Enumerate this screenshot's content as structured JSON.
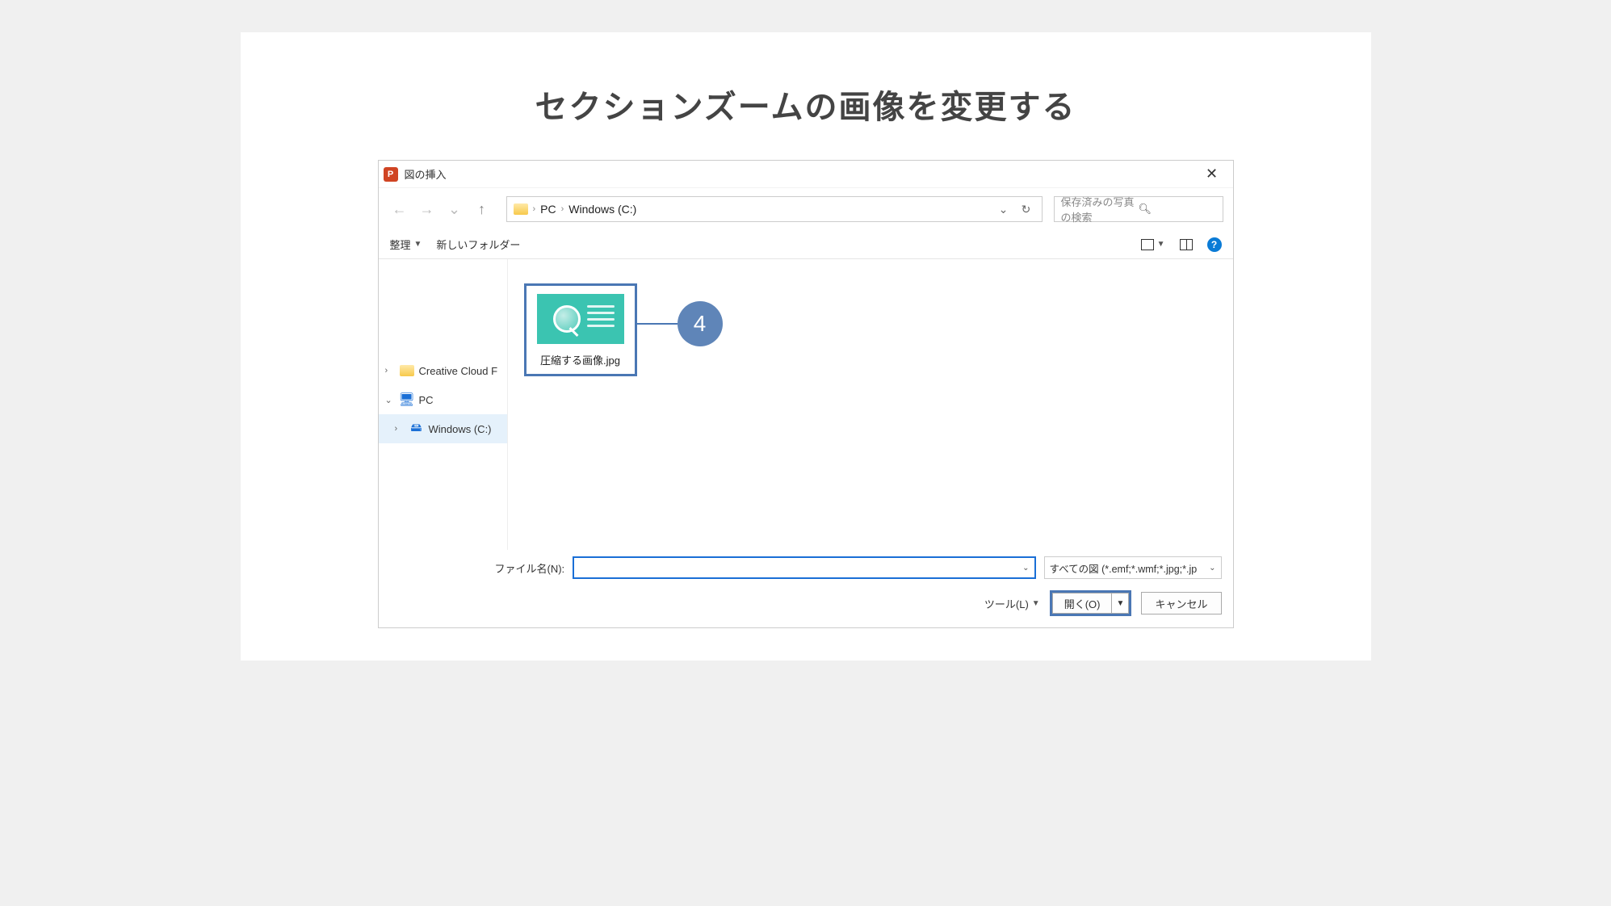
{
  "slide": {
    "title": "セクションズームの画像を変更する"
  },
  "dialog": {
    "title": "図の挿入",
    "app_icon_letter": "P"
  },
  "nav": {
    "crumb1": "PC",
    "crumb2": "Windows (C:)"
  },
  "search": {
    "placeholder": "保存済みの写真の検索"
  },
  "toolbar": {
    "organize": "整理",
    "new_folder": "新しいフォルダー"
  },
  "tree": {
    "item_cloud": "Creative Cloud F",
    "item_pc": "PC",
    "item_drive": "Windows (C:)"
  },
  "file": {
    "name": "圧縮する画像.jpg"
  },
  "callout": {
    "number": "4"
  },
  "footer": {
    "filename_label": "ファイル名(N):",
    "filetype": "すべての図 (*.emf;*.wmf;*.jpg;*.jp",
    "tools_label": "ツール(L)",
    "open_label": "開く(O)",
    "cancel_label": "キャンセル"
  }
}
